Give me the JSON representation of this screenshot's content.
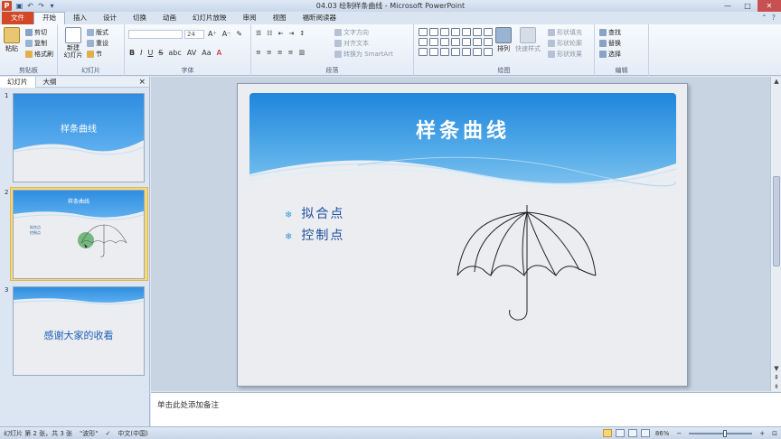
{
  "window": {
    "title": "04.03 绘制样条曲线 - Microsoft PowerPoint",
    "app_icon": "P",
    "controls": [
      "—",
      "□",
      "✕"
    ]
  },
  "quick_access": [
    "save-icon",
    "undo-icon",
    "redo-icon",
    "customize-icon"
  ],
  "tabs": [
    {
      "label": "文件",
      "kind": "file"
    },
    {
      "label": "开始",
      "kind": "active"
    },
    {
      "label": "插入"
    },
    {
      "label": "设计"
    },
    {
      "label": "切换"
    },
    {
      "label": "动画"
    },
    {
      "label": "幻灯片放映"
    },
    {
      "label": "审阅"
    },
    {
      "label": "视图"
    },
    {
      "label": "福昕阅读器"
    }
  ],
  "ribbon": {
    "clipboard": {
      "paste": "粘贴",
      "cut": "剪切",
      "copy": "复制",
      "format_painter": "格式刷",
      "label": "剪贴板"
    },
    "slides": {
      "new_slide": "新建\n幻灯片",
      "layout": "版式",
      "reset": "重设",
      "section": "节",
      "label": "幻灯片"
    },
    "font": {
      "font_name": "",
      "font_size": "24",
      "bold": "B",
      "italic": "I",
      "underline": "U",
      "strike": "S",
      "shadow": "abc",
      "spacing": "AV",
      "case": "Aa",
      "color": "A",
      "label": "字体"
    },
    "paragraph": {
      "text_direction": "文字方向",
      "align_text": "对齐文本",
      "smartart": "转换为 SmartArt",
      "label": "段落"
    },
    "drawing": {
      "arrange": "排列",
      "quick_styles": "快速样式",
      "shape_fill": "形状填充",
      "shape_outline": "形状轮廓",
      "shape_effects": "形状效果",
      "label": "绘图"
    },
    "editing": {
      "find": "查找",
      "replace": "替换",
      "select": "选择",
      "label": "编辑"
    }
  },
  "left_pane": {
    "tabs": [
      "幻灯片",
      "大纲"
    ],
    "close": "×",
    "slides": [
      {
        "num": "1",
        "title": "样条曲线"
      },
      {
        "num": "2",
        "title": "样条曲线",
        "bullets": [
          "拟合点",
          "控制点"
        ],
        "selected": true
      },
      {
        "num": "3",
        "text": "感谢大家的收看"
      }
    ]
  },
  "slide": {
    "title": "样条曲线",
    "bullets": [
      "拟合点",
      "控制点"
    ],
    "bullet_mark": "❄"
  },
  "notes": {
    "placeholder": "单击此处添加备注"
  },
  "status": {
    "slide_info": "幻灯片 第 2 张，共 3 张",
    "theme": "\"波形\"",
    "language": "中文(中国)",
    "zoom": "86%"
  },
  "colors": {
    "accent": "#d24726",
    "header_blue": "#1f86dc",
    "text_blue": "#1d4f9e"
  }
}
